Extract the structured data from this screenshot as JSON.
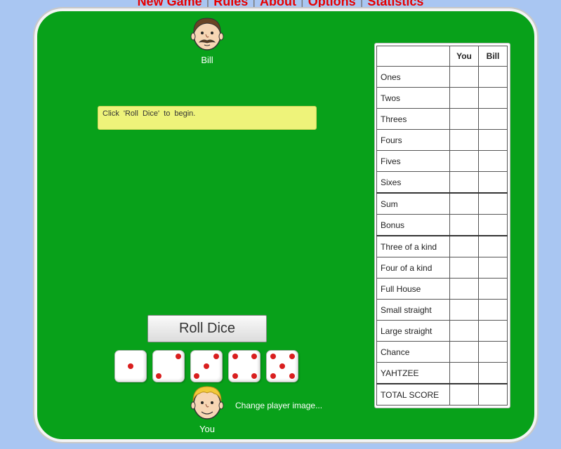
{
  "nav": {
    "items": [
      "New Game",
      "Rules",
      "About",
      "Options",
      "Statistics"
    ],
    "separator": "|"
  },
  "opponent": {
    "name": "Bill",
    "avatar_icon": "mustache-face-icon"
  },
  "player": {
    "name": "You",
    "avatar_icon": "blonde-face-icon",
    "change_image_label": "Change player image..."
  },
  "message": "Click 'Roll Dice' to begin.",
  "roll_button_label": "Roll Dice",
  "dice": [
    {
      "value": 1,
      "held": false
    },
    {
      "value": 2,
      "held": false
    },
    {
      "value": 3,
      "held": false
    },
    {
      "value": 4,
      "held": false
    },
    {
      "value": 5,
      "held": false
    }
  ],
  "scorecard": {
    "headers": {
      "category": "",
      "player": "You",
      "opponent": "Bill"
    },
    "rows": [
      {
        "label": "Ones",
        "you": "",
        "bill": ""
      },
      {
        "label": "Twos",
        "you": "",
        "bill": ""
      },
      {
        "label": "Threes",
        "you": "",
        "bill": ""
      },
      {
        "label": "Fours",
        "you": "",
        "bill": ""
      },
      {
        "label": "Fives",
        "you": "",
        "bill": ""
      },
      {
        "label": "Sixes",
        "you": "",
        "bill": ""
      },
      {
        "label": "Sum",
        "you": "",
        "bill": ""
      },
      {
        "label": "Bonus",
        "you": "",
        "bill": ""
      },
      {
        "label": "Three of a kind",
        "you": "",
        "bill": ""
      },
      {
        "label": "Four of a kind",
        "you": "",
        "bill": ""
      },
      {
        "label": "Full House",
        "you": "",
        "bill": ""
      },
      {
        "label": "Small straight",
        "you": "",
        "bill": ""
      },
      {
        "label": "Large straight",
        "you": "",
        "bill": ""
      },
      {
        "label": "Chance",
        "you": "",
        "bill": ""
      },
      {
        "label": "YAHTZEE",
        "you": "",
        "bill": ""
      },
      {
        "label": "TOTAL SCORE",
        "you": "",
        "bill": ""
      }
    ]
  },
  "colors": {
    "board": "#08a11a",
    "background": "#a9c6f2",
    "pip": "#d91e1e",
    "nav_link": "#e60000",
    "message_bg": "#eef37a"
  }
}
